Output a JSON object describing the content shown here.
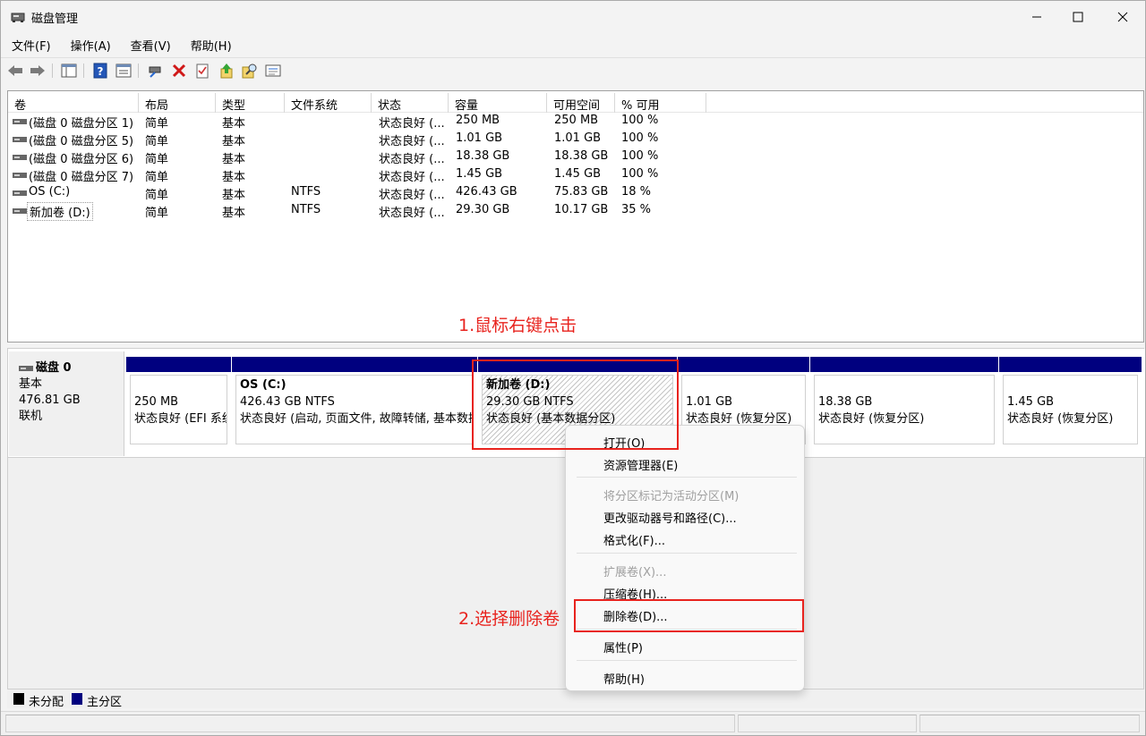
{
  "window": {
    "title": "磁盘管理"
  },
  "menu": [
    "文件(F)",
    "操作(A)",
    "查看(V)",
    "帮助(H)"
  ],
  "toolbar_icons": [
    "back-icon",
    "forward-icon",
    "console-tree-icon",
    "help-icon",
    "properties-icon",
    "connect-icon",
    "delete-icon",
    "checklist-icon",
    "upload-icon",
    "search-icon",
    "details-icon"
  ],
  "volume_table": {
    "columns": [
      "卷",
      "布局",
      "类型",
      "文件系统",
      "状态",
      "容量",
      "可用空间",
      "% 可用"
    ],
    "rows": [
      [
        "(磁盘 0 磁盘分区 1)",
        "简单",
        "基本",
        "",
        "状态良好 (...",
        "250 MB",
        "250 MB",
        "100 %"
      ],
      [
        "(磁盘 0 磁盘分区 5)",
        "简单",
        "基本",
        "",
        "状态良好 (...",
        "1.01 GB",
        "1.01 GB",
        "100 %"
      ],
      [
        "(磁盘 0 磁盘分区 6)",
        "简单",
        "基本",
        "",
        "状态良好 (...",
        "18.38 GB",
        "18.38 GB",
        "100 %"
      ],
      [
        "(磁盘 0 磁盘分区 7)",
        "简单",
        "基本",
        "",
        "状态良好 (...",
        "1.45 GB",
        "1.45 GB",
        "100 %"
      ],
      [
        "OS (C:)",
        "简单",
        "基本",
        "NTFS",
        "状态良好 (...",
        "426.43 GB",
        "75.83 GB",
        "18 %"
      ],
      [
        "新加卷 (D:)",
        "简单",
        "基本",
        "NTFS",
        "状态良好 (...",
        "29.30 GB",
        "10.17 GB",
        "35 %"
      ]
    ]
  },
  "disk": {
    "name": "磁盘 0",
    "type": "基本",
    "size": "476.81 GB",
    "status": "联机",
    "partitions": [
      {
        "name": "",
        "size": "250 MB",
        "status": "状态良好 (EFI 系统分区)"
      },
      {
        "name": "OS  (C:)",
        "size": "426.43 GB NTFS",
        "status": "状态良好 (启动, 页面文件, 故障转储, 基本数据分区)"
      },
      {
        "name": "新加卷  (D:)",
        "size": "29.30 GB NTFS",
        "status": "状态良好 (基本数据分区)"
      },
      {
        "name": "",
        "size": "1.01 GB",
        "status": "状态良好 (恢复分区)"
      },
      {
        "name": "",
        "size": "18.38 GB",
        "status": "状态良好 (恢复分区)"
      },
      {
        "name": "",
        "size": "1.45 GB",
        "status": "状态良好 (恢复分区)"
      }
    ]
  },
  "context_menu": {
    "open": "打开(O)",
    "explorer": "资源管理器(E)",
    "mark_active": "将分区标记为活动分区(M)",
    "change_letter": "更改驱动器号和路径(C)...",
    "format": "格式化(F)...",
    "extend": "扩展卷(X)...",
    "shrink": "压缩卷(H)...",
    "delete": "删除卷(D)...",
    "properties": "属性(P)",
    "help": "帮助(H)"
  },
  "legend": {
    "unallocated": "未分配",
    "primary": "主分区"
  },
  "annotations": {
    "step1": "1.鼠标右键点击",
    "step2": "2.选择删除卷"
  },
  "colors": {
    "primary_partition": "#00007f",
    "annotation": "#e8231e"
  }
}
